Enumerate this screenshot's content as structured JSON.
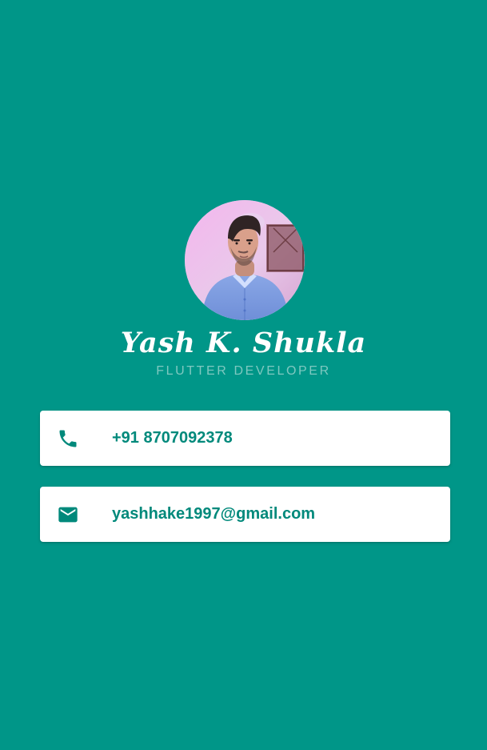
{
  "profile": {
    "name": "Yash K. Shukla",
    "title": "FLUTTER DEVELOPER",
    "avatar_icon": "profile-photo"
  },
  "contacts": {
    "phone": {
      "icon": "phone-icon",
      "value": "+91 8707092378"
    },
    "email": {
      "icon": "mail-icon",
      "value": "yashhake1997@gmail.com"
    }
  },
  "colors": {
    "background": "#009688",
    "card": "#ffffff",
    "accent": "#00897b",
    "subtitle": "#7fc8c0"
  }
}
